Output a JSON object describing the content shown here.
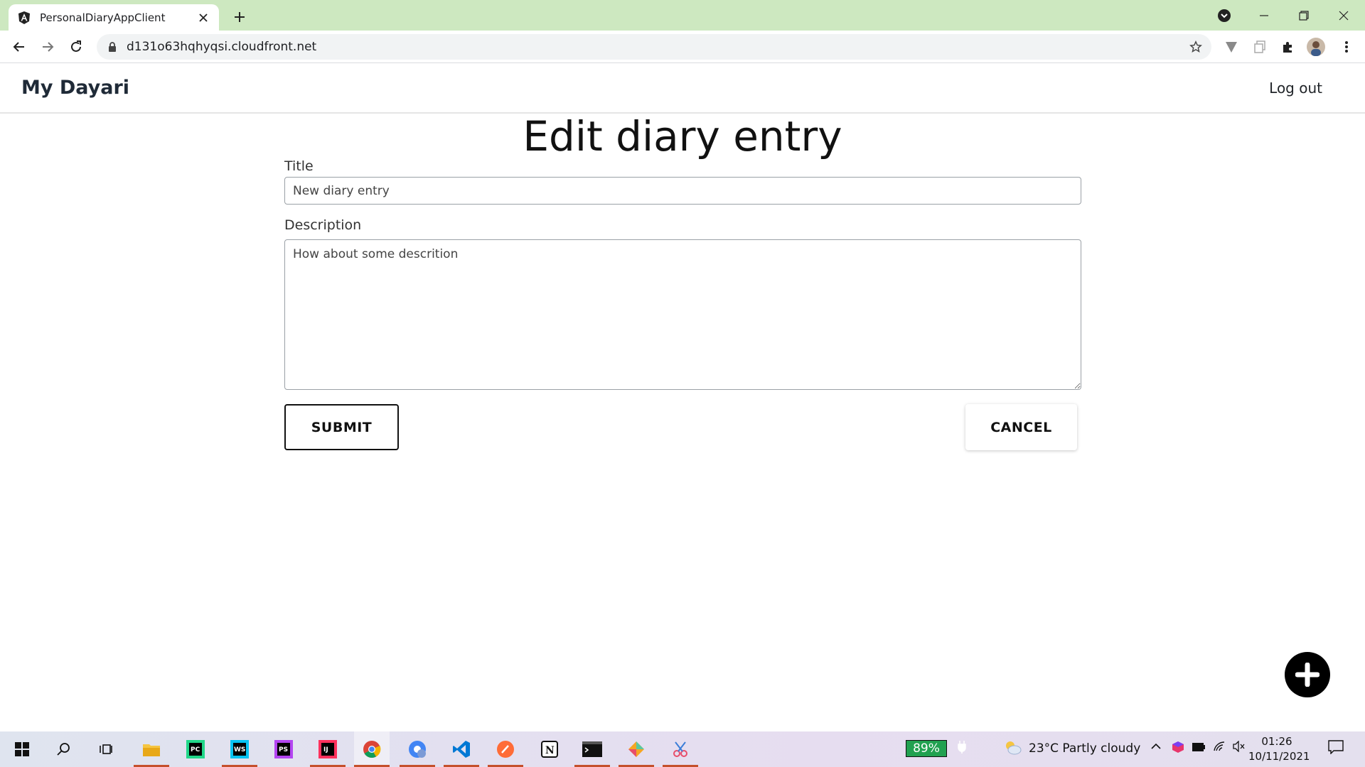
{
  "browser": {
    "tab_title": "PersonalDiaryAppClient",
    "url": "d131o63hqhyqsi.cloudfront.net",
    "tab_strip_color": "#cde8c0"
  },
  "app": {
    "brand": "My Dayari",
    "logout_label": "Log out"
  },
  "form": {
    "heading": "Edit diary entry",
    "title_label": "Title",
    "title_value": "New diary entry",
    "description_label": "Description",
    "description_value": "How about some descrition",
    "submit_label": "SUBMIT",
    "cancel_label": "CANCEL"
  },
  "fab": {
    "icon": "plus-icon"
  },
  "taskbar": {
    "battery_percent": "89%",
    "weather": "23°C  Partly cloudy",
    "time": "01:26",
    "date": "10/11/2021",
    "apps": [
      "windows-start",
      "search",
      "task-view",
      "file-explorer",
      "pycharm",
      "webstorm",
      "phpstorm",
      "intellij",
      "chrome",
      "chrome-profile",
      "vscode",
      "postman",
      "notion",
      "terminal",
      "git-kraken",
      "snipping-tool"
    ]
  }
}
